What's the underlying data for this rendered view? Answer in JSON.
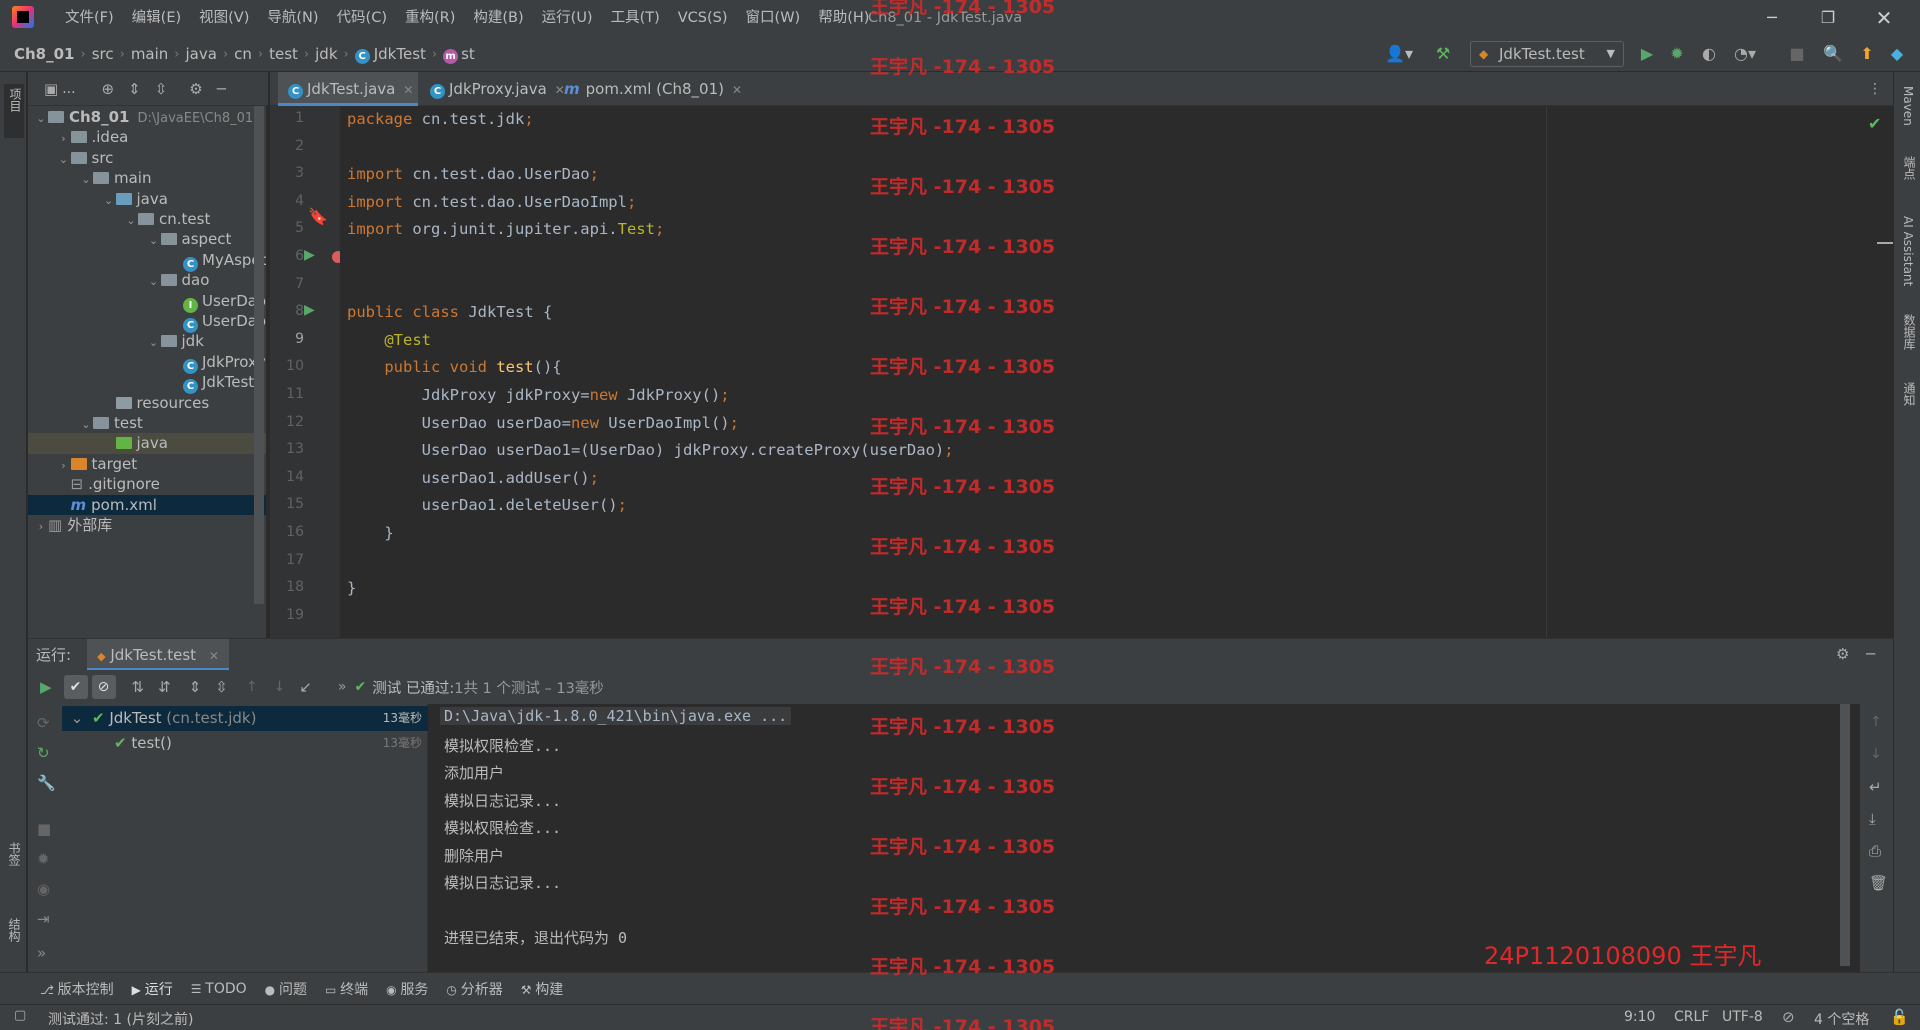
{
  "window": {
    "menu": [
      "文件(F)",
      "编辑(E)",
      "视图(V)",
      "导航(N)",
      "代码(C)",
      "重构(R)",
      "构建(B)",
      "运行(U)",
      "工具(T)",
      "VCS(S)",
      "窗口(W)",
      "帮助(H)"
    ],
    "title": "Ch8_01 - JdkTest.java"
  },
  "breadcrumb": [
    "Ch8_01",
    "src",
    "main",
    "java",
    "cn",
    "test",
    "jdk",
    "JdkTest",
    "st"
  ],
  "run_config": "JdkTest.test",
  "left_stripe": {
    "project": "项目",
    "bookmarks": "书签",
    "structure": "结构"
  },
  "right_stripe": [
    "Maven",
    "端点",
    "AI Assistant",
    "数据库",
    "通知"
  ],
  "project_toolbar": {
    "label": "..."
  },
  "project_tree": [
    {
      "label": "Ch8_01",
      "extra": "D:\\JavaEE\\Ch8_01",
      "depth": 0,
      "arrow": "open",
      "icon": "folder"
    },
    {
      "label": ".idea",
      "depth": 1,
      "arrow": "closed",
      "icon": "folder"
    },
    {
      "label": "src",
      "depth": 1,
      "arrow": "open",
      "icon": "folder"
    },
    {
      "label": "main",
      "depth": 2,
      "arrow": "open",
      "icon": "folder"
    },
    {
      "label": "java",
      "depth": 3,
      "arrow": "open",
      "icon": "folder-src"
    },
    {
      "label": "cn.test",
      "depth": 4,
      "arrow": "open",
      "icon": "folder"
    },
    {
      "label": "aspect",
      "depth": 5,
      "arrow": "open",
      "icon": "folder"
    },
    {
      "label": "MyAspect",
      "depth": 6,
      "arrow": "",
      "icon": "class"
    },
    {
      "label": "dao",
      "depth": 5,
      "arrow": "open",
      "icon": "folder"
    },
    {
      "label": "UserDao",
      "depth": 6,
      "arrow": "",
      "icon": "interface"
    },
    {
      "label": "UserDaoImpl",
      "depth": 6,
      "arrow": "",
      "icon": "class"
    },
    {
      "label": "jdk",
      "depth": 5,
      "arrow": "open",
      "icon": "folder"
    },
    {
      "label": "JdkProxy",
      "depth": 6,
      "arrow": "",
      "icon": "class"
    },
    {
      "label": "JdkTest",
      "depth": 6,
      "arrow": "",
      "icon": "class"
    },
    {
      "label": "resources",
      "depth": 3,
      "arrow": "",
      "icon": "folder-res"
    },
    {
      "label": "test",
      "depth": 2,
      "arrow": "open",
      "icon": "folder"
    },
    {
      "label": "java",
      "depth": 3,
      "arrow": "",
      "icon": "folder-green"
    },
    {
      "label": "target",
      "depth": 1,
      "arrow": "closed",
      "icon": "folder-orange"
    },
    {
      "label": ".gitignore",
      "depth": 1,
      "arrow": "",
      "icon": "file"
    },
    {
      "label": "pom.xml",
      "depth": 1,
      "arrow": "",
      "icon": "maven"
    },
    {
      "label": "外部库",
      "depth": 0,
      "arrow": "closed",
      "icon": "library"
    }
  ],
  "editor_tabs": [
    {
      "label": "JdkTest.java",
      "icon": "class",
      "active": true
    },
    {
      "label": "JdkProxy.java",
      "icon": "class",
      "active": false
    },
    {
      "label": "pom.xml (Ch8_01)",
      "icon": "maven",
      "active": false
    }
  ],
  "code_lines": [
    [
      {
        "t": "package ",
        "c": "kw"
      },
      {
        "t": "cn.test.jdk",
        "c": ""
      },
      {
        "t": ";",
        "c": "kw"
      }
    ],
    [],
    [
      {
        "t": "import ",
        "c": "kw"
      },
      {
        "t": "cn.test.dao.UserDao",
        "c": ""
      },
      {
        "t": ";",
        "c": "kw"
      }
    ],
    [
      {
        "t": "import ",
        "c": "kw"
      },
      {
        "t": "cn.test.dao.UserDaoImpl",
        "c": ""
      },
      {
        "t": ";",
        "c": "kw"
      }
    ],
    [
      {
        "t": "import ",
        "c": "kw"
      },
      {
        "t": "org.junit.jupiter.api.",
        "c": ""
      },
      {
        "t": "Test",
        "c": "ann"
      },
      {
        "t": ";",
        "c": "kw"
      }
    ],
    [],
    [],
    [
      {
        "t": "public class ",
        "c": "kw"
      },
      {
        "t": "JdkTest {",
        "c": ""
      }
    ],
    [
      {
        "t": "    @Test",
        "c": "ann"
      }
    ],
    [
      {
        "t": "    public void ",
        "c": "kw"
      },
      {
        "t": "test",
        "c": "fn"
      },
      {
        "t": "(){",
        "c": ""
      }
    ],
    [
      {
        "t": "        JdkProxy jdkProxy=",
        "c": ""
      },
      {
        "t": "new ",
        "c": "kw"
      },
      {
        "t": "JdkProxy()",
        "c": ""
      },
      {
        "t": ";",
        "c": "kw"
      }
    ],
    [
      {
        "t": "        UserDao userDao=",
        "c": ""
      },
      {
        "t": "new ",
        "c": "kw"
      },
      {
        "t": "UserDaoImpl()",
        "c": ""
      },
      {
        "t": ";",
        "c": "kw"
      }
    ],
    [
      {
        "t": "        UserDao userDao1=(UserDao) jdkProxy.createProxy(userDao)",
        "c": ""
      },
      {
        "t": ";",
        "c": "kw"
      }
    ],
    [
      {
        "t": "        userDao1.addUser()",
        "c": ""
      },
      {
        "t": ";",
        "c": "kw"
      }
    ],
    [
      {
        "t": "        userDao1.deleteUser()",
        "c": ""
      },
      {
        "t": ";",
        "c": "kw"
      }
    ],
    [
      {
        "t": "    }",
        "c": ""
      }
    ],
    [],
    [
      {
        "t": "}",
        "c": ""
      }
    ],
    []
  ],
  "line_numbers": [
    "1",
    "2",
    "3",
    "4",
    "5",
    "6",
    "7",
    "8",
    "9",
    "10",
    "11",
    "12",
    "13",
    "14",
    "15",
    "16",
    "17",
    "18",
    "19"
  ],
  "run_panel": {
    "label": "运行:",
    "tab": "JdkTest.test",
    "status_prefix": "测试 已通过:",
    "status_detail": " 1共 1 个测试 – 13毫秒"
  },
  "test_tree": [
    {
      "label": "JdkTest",
      "sub": " (cn.test.jdk)",
      "time": "13毫秒"
    },
    {
      "label": "test()",
      "sub": "",
      "time": "13毫秒"
    }
  ],
  "console_lines": [
    "D:\\Java\\jdk-1.8.0_421\\bin\\java.exe ...",
    "模拟权限检查...",
    "添加用户",
    "模拟日志记录...",
    "模拟权限检查...",
    "删除用户",
    "模拟日志记录...",
    "",
    "进程已结束，退出代码为 0"
  ],
  "bottom_tools": [
    "版本控制",
    "运行",
    "TODO",
    "问题",
    "终端",
    "服务",
    "分析器",
    "构建"
  ],
  "status_bar": {
    "message": "测试通过: 1 (片刻之前)",
    "position": "9:10",
    "line_sep": "CRLF",
    "encoding": "UTF-8",
    "indent": "4 个空格"
  },
  "watermark": {
    "text": "王宇凡 -174 - 1305",
    "corner": "24P1120108090 王宇凡"
  }
}
